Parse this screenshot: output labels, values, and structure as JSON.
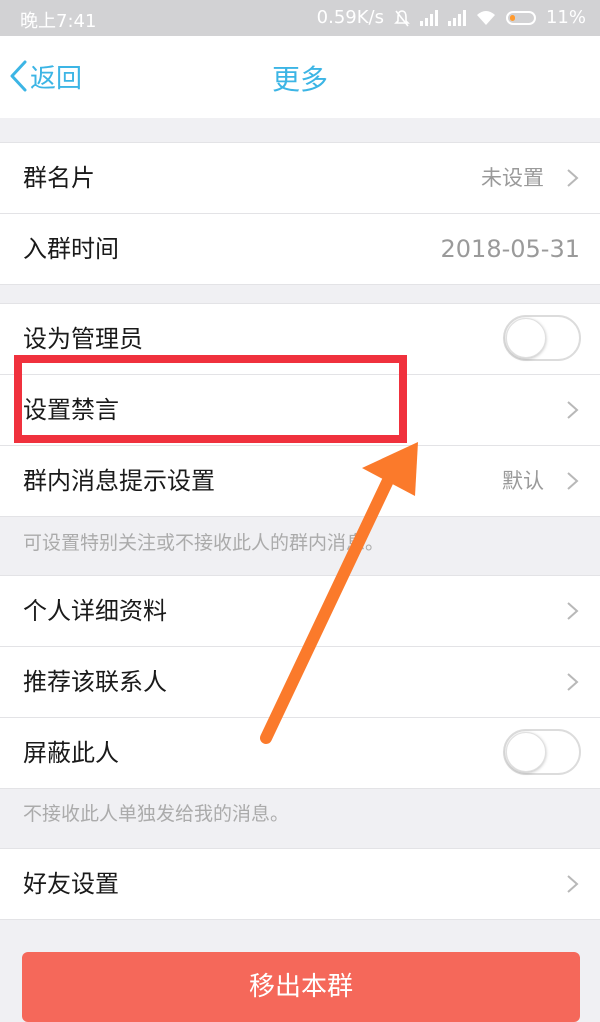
{
  "status_bar": {
    "time": "晚上7:41",
    "speed": "0.59K/s",
    "battery": "11%"
  },
  "nav": {
    "back_label": "返回",
    "title": "更多"
  },
  "section1": {
    "group_card": {
      "label": "群名片",
      "value": "未设置"
    },
    "join_time": {
      "label": "入群时间",
      "value": "2018-05-31"
    }
  },
  "section2": {
    "set_admin": {
      "label": "设为管理员",
      "toggle_on": false
    },
    "mute": {
      "label": "设置禁言"
    },
    "msg_notice": {
      "label": "群内消息提示设置",
      "value": "默认"
    },
    "hint": "可设置特别关注或不接收此人的群内消息。"
  },
  "section3": {
    "profile": {
      "label": "个人详细资料"
    },
    "recommend": {
      "label": "推荐该联系人"
    },
    "block": {
      "label": "屏蔽此人",
      "toggle_on": false
    },
    "hint": "不接收此人单独发给我的消息。"
  },
  "section4": {
    "friend_settings": {
      "label": "好友设置"
    }
  },
  "remove_button": {
    "label": "移出本群"
  },
  "colors": {
    "accent": "#3cb5e5",
    "highlight_red": "#f0313d",
    "arrow_orange": "#fb7a2b",
    "danger_button": "#f5685a"
  }
}
